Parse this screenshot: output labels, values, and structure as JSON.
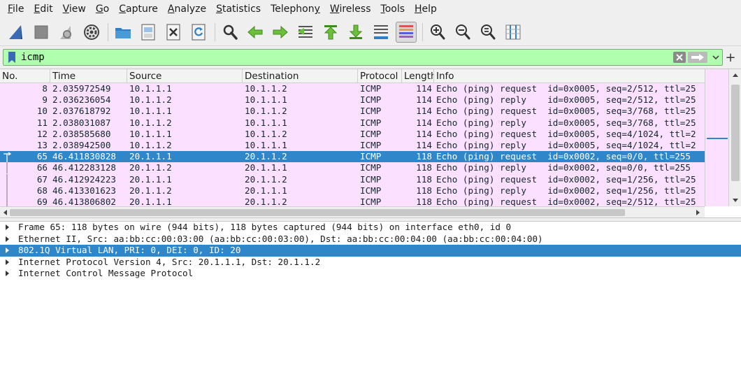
{
  "menu": [
    {
      "pre": "",
      "ul": "F",
      "post": "ile"
    },
    {
      "pre": "",
      "ul": "E",
      "post": "dit"
    },
    {
      "pre": "",
      "ul": "V",
      "post": "iew"
    },
    {
      "pre": "",
      "ul": "G",
      "post": "o"
    },
    {
      "pre": "",
      "ul": "C",
      "post": "apture"
    },
    {
      "pre": "",
      "ul": "A",
      "post": "nalyze"
    },
    {
      "pre": "",
      "ul": "S",
      "post": "tatistics"
    },
    {
      "pre": "Telephon",
      "ul": "y",
      "post": ""
    },
    {
      "pre": "",
      "ul": "W",
      "post": "ireless"
    },
    {
      "pre": "",
      "ul": "T",
      "post": "ools"
    },
    {
      "pre": "",
      "ul": "H",
      "post": "elp"
    }
  ],
  "filter": {
    "value": "icmp"
  },
  "columns": [
    "No.",
    "Time",
    "Source",
    "Destination",
    "Protocol",
    "Length",
    "Info"
  ],
  "packets": [
    [
      "8",
      "2.035972549",
      "10.1.1.1",
      "10.1.1.2",
      "ICMP",
      "114",
      "Echo (ping) request  id=0x0005, seq=2/512, ttl=25"
    ],
    [
      "9",
      "2.036236054",
      "10.1.1.2",
      "10.1.1.1",
      "ICMP",
      "114",
      "Echo (ping) reply    id=0x0005, seq=2/512, ttl=25"
    ],
    [
      "10",
      "2.037618792",
      "10.1.1.1",
      "10.1.1.2",
      "ICMP",
      "114",
      "Echo (ping) request  id=0x0005, seq=3/768, ttl=25"
    ],
    [
      "11",
      "2.038031087",
      "10.1.1.2",
      "10.1.1.1",
      "ICMP",
      "114",
      "Echo (ping) reply    id=0x0005, seq=3/768, ttl=25"
    ],
    [
      "12",
      "2.038585680",
      "10.1.1.1",
      "10.1.1.2",
      "ICMP",
      "114",
      "Echo (ping) request  id=0x0005, seq=4/1024, ttl=2"
    ],
    [
      "13",
      "2.038942500",
      "10.1.1.2",
      "10.1.1.1",
      "ICMP",
      "114",
      "Echo (ping) reply    id=0x0005, seq=4/1024, ttl=2"
    ],
    [
      "65",
      "46.411830828",
      "20.1.1.1",
      "20.1.1.2",
      "ICMP",
      "118",
      "Echo (ping) request  id=0x0002, seq=0/0, ttl=255"
    ],
    [
      "66",
      "46.412283128",
      "20.1.1.2",
      "20.1.1.1",
      "ICMP",
      "118",
      "Echo (ping) reply    id=0x0002, seq=0/0, ttl=255"
    ],
    [
      "67",
      "46.412924223",
      "20.1.1.1",
      "20.1.1.2",
      "ICMP",
      "118",
      "Echo (ping) request  id=0x0002, seq=1/256, ttl=25"
    ],
    [
      "68",
      "46.413301623",
      "20.1.1.2",
      "20.1.1.1",
      "ICMP",
      "118",
      "Echo (ping) reply    id=0x0002, seq=1/256, ttl=25"
    ],
    [
      "69",
      "46.413806802",
      "20.1.1.1",
      "20.1.1.2",
      "ICMP",
      "118",
      "Echo (ping) request  id=0x0002, seq=2/512, ttl=25"
    ]
  ],
  "selected_packet": "65",
  "details": [
    {
      "text": "Frame 65: 118 bytes on wire (944 bits), 118 bytes captured (944 bits) on interface eth0, id 0",
      "selected": false
    },
    {
      "text": "Ethernet II, Src: aa:bb:cc:00:03:00 (aa:bb:cc:00:03:00), Dst: aa:bb:cc:00:04:00 (aa:bb:cc:00:04:00)",
      "selected": false
    },
    {
      "text": "802.1Q Virtual LAN, PRI: 0, DEI: 0, ID: 20",
      "selected": true
    },
    {
      "text": "Internet Protocol Version 4, Src: 20.1.1.1, Dst: 20.1.1.2",
      "selected": false
    },
    {
      "text": "Internet Control Message Protocol",
      "selected": false
    }
  ],
  "colors": {
    "row_bg": "#fce0ff",
    "row_text": "#12272e",
    "selected_bg": "#2f86c8",
    "filter_valid_bg": "#afffaf"
  },
  "toolbar_icons": [
    "shark-fin-start-icon",
    "stop-square-icon",
    "restart-fin-icon",
    "capture-options-gear-icon",
    "open-folder-icon",
    "save-file-icon",
    "close-file-icon",
    "reload-icon",
    "find-packet-magnifier-icon",
    "go-back-arrow-icon",
    "go-forward-arrow-icon",
    "go-to-packet-icon",
    "first-packet-icon",
    "last-packet-icon",
    "auto-scroll-icon",
    "colorize-icon",
    "zoom-in-icon",
    "zoom-out-icon",
    "normal-size-icon",
    "resize-columns-icon"
  ]
}
